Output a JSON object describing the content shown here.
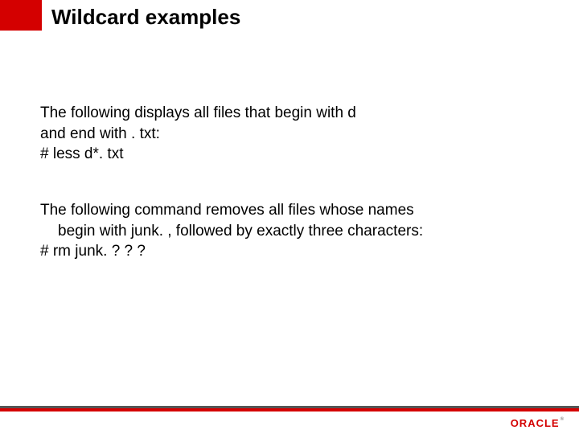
{
  "title": "Wildcard examples",
  "para1": {
    "line1": "The following displays all files that begin with d",
    "line2": "and end with . txt:",
    "line3": "#   less    d*. txt"
  },
  "para2": {
    "line1": "The following command removes all files whose names",
    "line2": "begin with junk. , followed by exactly three characters:",
    "line3": "#   rm   junk. ? ? ?"
  },
  "logo": "ORACLE"
}
